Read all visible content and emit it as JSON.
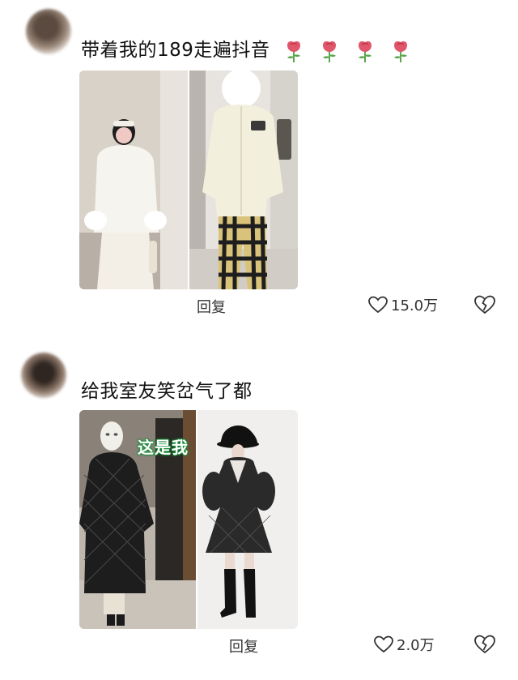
{
  "comments": [
    {
      "text": "带着我的189走遍抖音",
      "emoji": [
        "rose-emoji",
        "rose-emoji",
        "rose-emoji",
        "rose-emoji"
      ],
      "reply_label": "回复",
      "like_count": "15.0万",
      "icons": {
        "like": "heart-outline-icon",
        "dislike": "broken-heart-icon"
      }
    },
    {
      "text": "给我室友笑岔气了都",
      "image_overlay_text": "这是我",
      "reply_label": "回复",
      "like_count": "2.0万",
      "icons": {
        "like": "heart-outline-icon",
        "dislike": "broken-heart-icon"
      }
    }
  ],
  "colors": {
    "text": "#111111",
    "secondary": "#333333",
    "overlay_stroke": "#1a8f3a",
    "rose": "#e0566b"
  }
}
